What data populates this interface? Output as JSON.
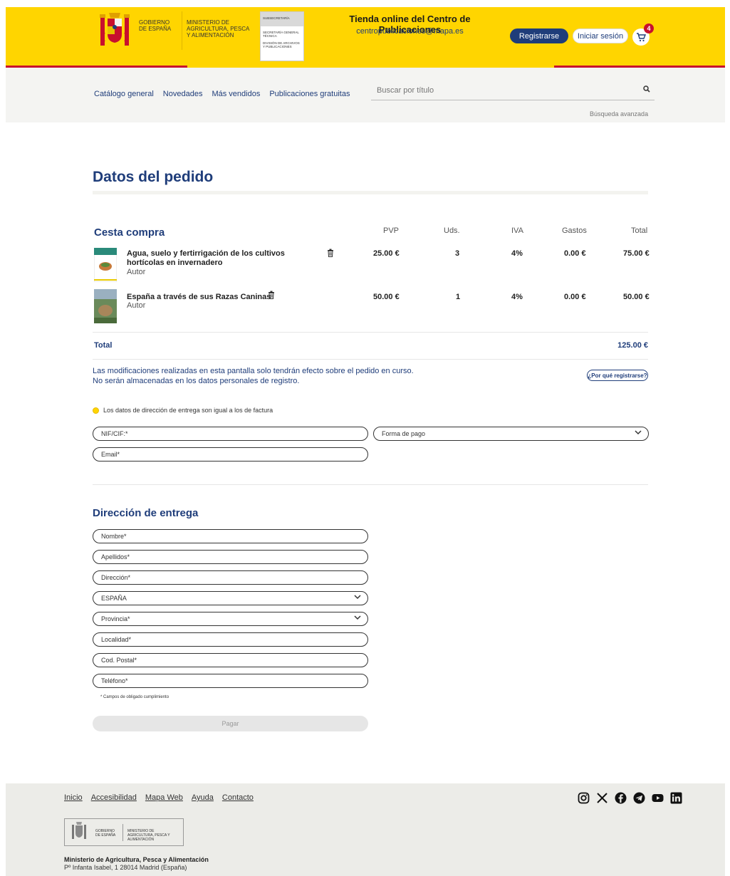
{
  "header": {
    "gobierno": "GOBIERNO DE ESPAÑA",
    "ministerio": "MINISTERIO DE AGRICULTURA, PESCA Y ALIMENTACIÓN",
    "sub_top": "SUBSECRETARÍA",
    "sub_mid1": "SECRETARÍA GENERAL TÉCNICA",
    "sub_mid2": "DIVISIÓN DE ARCHIVOS Y PUBLICACIONES",
    "store_title": "Tienda online del Centro de Publicaciones",
    "store_email": "centropublicaciones@mapa.es",
    "register_label": "Registrarse",
    "login_label": "Iniciar sesión",
    "cart_count": "4"
  },
  "nav": {
    "links": [
      "Catálogo general",
      "Novedades",
      "Más vendidos",
      "Publicaciones gratuitas"
    ],
    "search_placeholder": "Buscar por título",
    "advanced_search": "Búsqueda avanzada"
  },
  "page": {
    "title": "Datos del pedido"
  },
  "cart": {
    "title": "Cesta compra",
    "columns": [
      "PVP",
      "Uds.",
      "IVA",
      "Gastos",
      "Total"
    ],
    "items": [
      {
        "title": "Agua, suelo y fertirrigación de los cultivos hortícolas en invernadero",
        "author": "Autor",
        "pvp": "25.00 €",
        "uds": "3",
        "iva": "4%",
        "gastos": "0.00 €",
        "total": "75.00 €"
      },
      {
        "title": "España a través de sus Razas Caninas",
        "author": "Autor",
        "pvp": "50.00 €",
        "uds": "1",
        "iva": "4%",
        "gastos": "0.00 €",
        "total": "50.00 €"
      }
    ],
    "total_label": "Total",
    "total_value": "125.00 €"
  },
  "notice": {
    "line1": "Las modificaciones realizadas en esta pantalla solo tendrán efecto sobre el pedido en curso.",
    "line2": "No serán almacenadas en los datos personales de registro.",
    "why_label": "¿Por qué registrarse?"
  },
  "billing": {
    "same_address": "Los datos de dirección de entrega son igual a los de factura",
    "nif": "NIF/CIF:*",
    "payment": "Forma de pago",
    "email": "Email*"
  },
  "delivery": {
    "title": "Dirección de entrega",
    "fields": {
      "nombre": "Nombre*",
      "apellidos": "Apellidos*",
      "direccion": "Dirección*",
      "pais": "ESPAÑA",
      "provincia": "Provincia*",
      "localidad": "Localidad*",
      "cp": "Cod. Postal*",
      "telefono": "Teléfono*"
    },
    "required_note": "* Campos de obligado cumplimiento",
    "pay_label": "Pagar"
  },
  "footer": {
    "links": [
      "Inicio",
      "Accesibilidad",
      "Mapa Web",
      "Ayuda",
      "Contacto"
    ],
    "logo_gobierno": "GOBIERNO DE ESPAÑA",
    "logo_ministerio": "MINISTERIO DE AGRICULTURA, PESCA Y ALIMENTACIÓN",
    "org": "Ministerio de Agricultura, Pesca y Alimentación",
    "address": "Pº Infanta Isabel, 1 28014 Madrid (España)",
    "social": [
      "instagram-icon",
      "x-icon",
      "facebook-icon",
      "telegram-icon",
      "youtube-icon",
      "linkedin-icon"
    ]
  }
}
